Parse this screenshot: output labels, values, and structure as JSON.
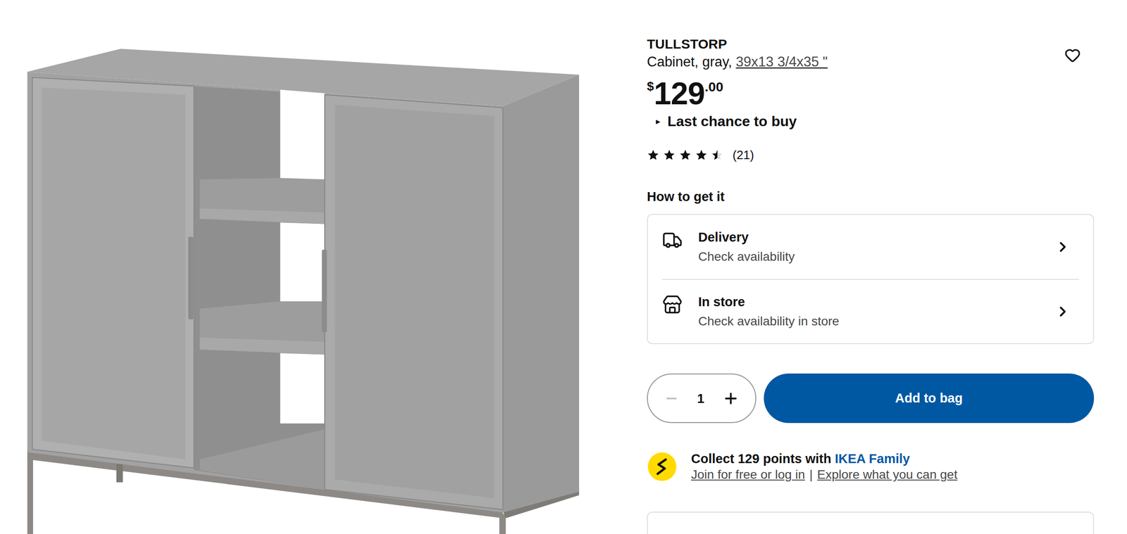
{
  "product": {
    "name": "TULLSTORP",
    "description": "Cabinet, gray, ",
    "size": "39x13 3/4x35 \"",
    "favorite": false
  },
  "price": {
    "currency": "$",
    "whole": "129",
    "fraction": ".00"
  },
  "notice": {
    "marker": "▸",
    "label": "Last chance to buy",
    "expanded": false
  },
  "rating": {
    "stars": 4.5,
    "count": "(21)"
  },
  "fulfilment": {
    "title": "How to get it",
    "options": [
      {
        "kind": "delivery",
        "label": "Delivery",
        "status": "Check availability"
      },
      {
        "kind": "store",
        "label": "In store",
        "status": "Check availability in store"
      }
    ]
  },
  "quantity": {
    "value": "1",
    "decrease_disabled": true
  },
  "add_button": "Add to bag",
  "family": {
    "text": "Collect 129 points with ",
    "brand": "IKEA Family",
    "links": [
      "Join for free or log in",
      "Explore what you can get"
    ],
    "separator": "|"
  }
}
